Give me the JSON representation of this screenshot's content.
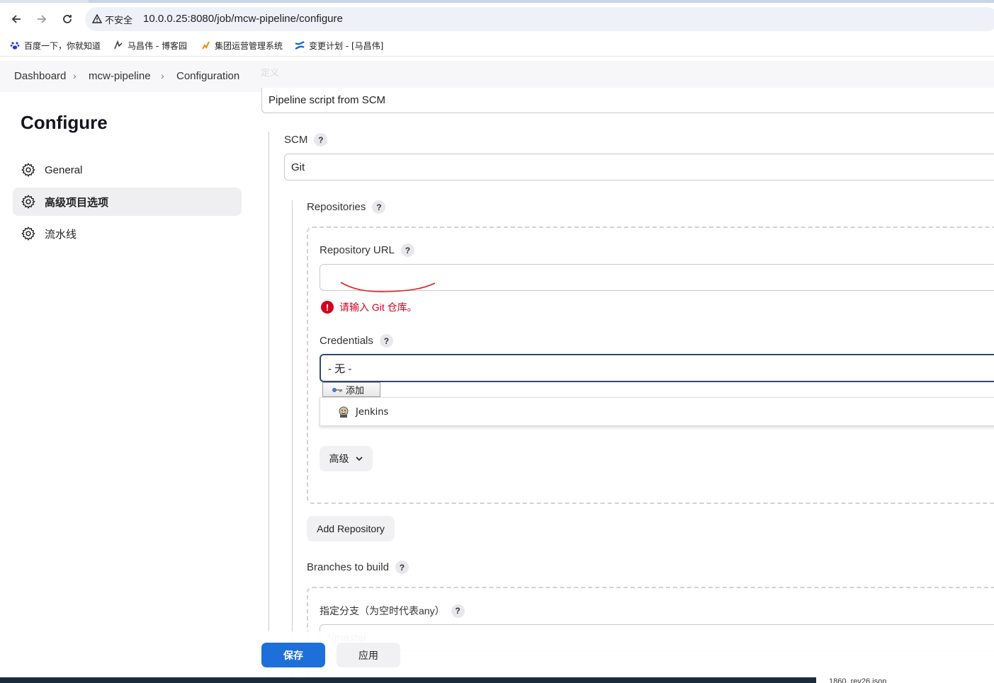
{
  "browser": {
    "insecure_label": "不安全",
    "url": "10.0.0.25:8080/job/mcw-pipeline/configure",
    "bookmarks": [
      "百度一下，你就知道",
      "马昌伟 - 博客园",
      "集团运营管理系统",
      "变更计划 - [马昌伟]"
    ]
  },
  "breadcrumb": [
    "Dashboard",
    "mcw-pipeline",
    "Configuration"
  ],
  "faded_label": "定义",
  "sidebar": {
    "title": "Configure",
    "items": [
      {
        "label": "General",
        "active": false
      },
      {
        "label": "高级项目选项",
        "active": true
      },
      {
        "label": "流水线",
        "active": false
      }
    ]
  },
  "definition": {
    "value": "Pipeline script from SCM"
  },
  "scm": {
    "label": "SCM",
    "value": "Git"
  },
  "repositories": {
    "label": "Repositories",
    "repo_url_label": "Repository URL",
    "repo_url_value": "",
    "error": "请输入 Git 仓库。",
    "credentials_label": "Credentials",
    "credentials_value": "- 无 -",
    "add_label": "添加",
    "dropdown_items": [
      "Jenkins"
    ],
    "advanced_label": "高级",
    "add_repository_label": "Add Repository"
  },
  "branches": {
    "label": "Branches to build",
    "specifier_label": "指定分支（为空时代表any）",
    "specifier_placeholder": "*/master"
  },
  "actions": {
    "save": "保存",
    "apply": "应用"
  },
  "taskbar_file": "1860_rev26.json",
  "colors": {
    "primary": "#1e6fd9",
    "error": "#d2001f",
    "annotation": "#e02020"
  }
}
